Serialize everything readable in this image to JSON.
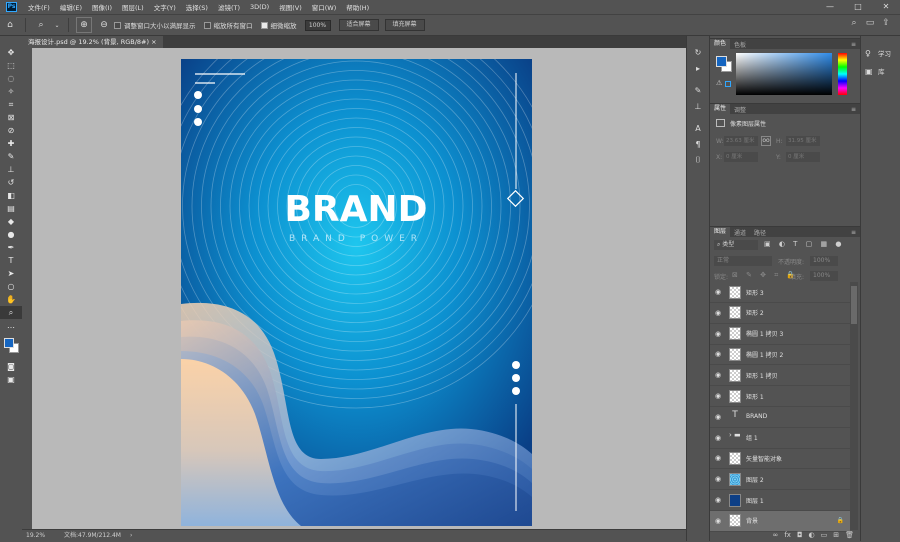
{
  "menu": {
    "items": [
      "文件(F)",
      "编辑(E)",
      "图像(I)",
      "图层(L)",
      "文字(Y)",
      "选择(S)",
      "滤镜(T)",
      "3D(D)",
      "视图(V)",
      "窗口(W)",
      "帮助(H)"
    ]
  },
  "window_controls": {
    "minimize": "—",
    "restore": "□",
    "close": "✕"
  },
  "options": {
    "check1_label": "调整窗口大小以满屏显示",
    "check2_label": "缩放所有窗口",
    "check3_label": "细微缩放",
    "zoom_value": "100%",
    "fit_screen": "适合屏幕",
    "fill_screen": "填充屏幕"
  },
  "document": {
    "tab_title": "海报设计.psd @ 19.2% (背景, RGB/8#)",
    "zoom": "19.2%",
    "doc_info": "文档:47.9M/212.4M"
  },
  "poster": {
    "title": "BRAND",
    "subtitle": "BRAND POWER"
  },
  "learn": {
    "learn_label": "学习",
    "library_label": "库"
  },
  "color_panel": {
    "tab1": "颜色",
    "tab2": "色板",
    "fg_color": "#1565c0",
    "bg_color": "#ffffff"
  },
  "properties_panel": {
    "tab1": "属性",
    "tab2": "调整",
    "type_label": "像素图层属性",
    "w_label": "W:",
    "w_value": "23.63 厘米",
    "h_label": "H:",
    "h_value": "31.95 厘米",
    "x_label": "X:",
    "x_value": "0 厘米",
    "y_label": "Y:",
    "y_value": "0 厘米"
  },
  "layers_panel": {
    "tab1": "图层",
    "tab2": "通道",
    "tab3": "路径",
    "filter_label": "类型",
    "blend_mode": "正常",
    "opacity_label": "不透明度:",
    "opacity_value": "100%",
    "lock_label": "锁定:",
    "fill_label": "填充:",
    "fill_value": "100%",
    "layers": [
      {
        "name": "矩形 3",
        "kind": "shape"
      },
      {
        "name": "矩形 2",
        "kind": "shape"
      },
      {
        "name": "椭圆 1 拷贝 3",
        "kind": "shape"
      },
      {
        "name": "椭圆 1 拷贝 2",
        "kind": "shape"
      },
      {
        "name": "矩形 1 拷贝",
        "kind": "shape"
      },
      {
        "name": "矩形 1",
        "kind": "shape"
      },
      {
        "name": "BRAND",
        "kind": "text"
      },
      {
        "name": "组 1",
        "kind": "group"
      },
      {
        "name": "矢量智能对象",
        "kind": "smart"
      },
      {
        "name": "图层 2",
        "kind": "pattern"
      },
      {
        "name": "图层 1",
        "kind": "fill"
      },
      {
        "name": "背景",
        "kind": "background"
      }
    ]
  }
}
